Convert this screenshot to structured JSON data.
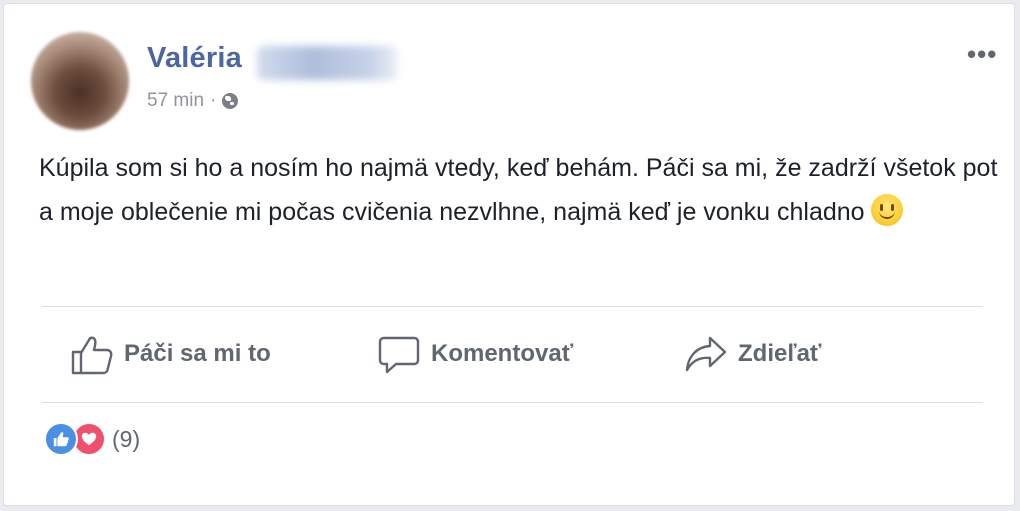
{
  "post": {
    "author_name": "Valéria",
    "timestamp": "57 min",
    "separator": "·",
    "privacy_icon": "globe-icon",
    "more_label": "•••",
    "text": "Kúpila som si ho a nosím ho najmä vtedy, keď behám. Páči sa mi, že zadrží všetok pot a moje oblečenie mi počas cvičenia nezvlhne, najmä keď je vonku chladno",
    "emoji": "slightly-smiling-face"
  },
  "actions": {
    "like_label": "Páči sa mi to",
    "comment_label": "Komentovať",
    "share_label": "Zdieľať"
  },
  "reactions": {
    "icons": [
      "like-reaction-icon",
      "love-reaction-icon"
    ],
    "count": "(9)"
  },
  "colors": {
    "author": "#4b67a1",
    "meta": "#90949c",
    "action": "#606770",
    "like_reaction": "#4a90e2",
    "love_reaction": "#f0506e"
  }
}
